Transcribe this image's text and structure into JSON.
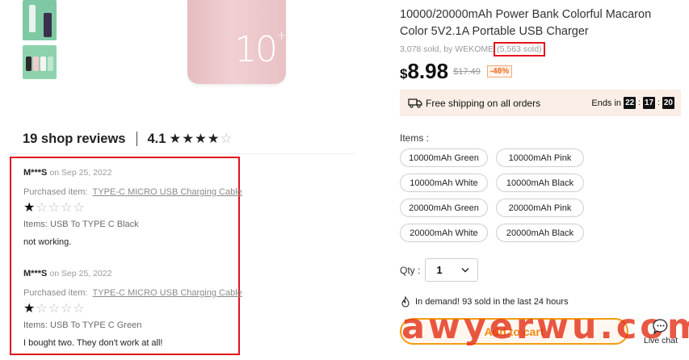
{
  "product": {
    "title": "10000/20000mAh Power Bank Colorful Macaron Color 5V2.1A Portable USB Charger",
    "sold_by": "3,078 sold, by WEKOME",
    "store_sold": "(5,563 sold)",
    "currency": "$",
    "price": "8.98",
    "old_price": "$17.49",
    "discount": "-48%",
    "hero_capacity": "10",
    "hero_plus": "+"
  },
  "shipping": {
    "label": "Free shipping on all orders",
    "ends_label": "Ends in",
    "timer": [
      "22",
      "17",
      "20"
    ]
  },
  "options": {
    "label": "Items :",
    "items": [
      "10000mAh Green",
      "10000mAh Pink",
      "10000mAh White",
      "10000mAh Black",
      "20000mAh Green",
      "20000mAh Pink",
      "20000mAh White",
      "20000mAh Black"
    ]
  },
  "quantity": {
    "label": "Qty :",
    "value": "1"
  },
  "demand": "In demand! 93 sold in the last 24 hours",
  "cart_button": "Add to cart",
  "live_chat": "Live chat",
  "watermark": "awyerwu.com",
  "shop_reviews": {
    "count_label": "19 shop reviews",
    "rating": "4.1",
    "stars": "★★★★",
    "empty_stars": "☆"
  },
  "reviews": [
    {
      "author": "M***S",
      "date": "on Sep 25, 2022",
      "purchased_label": "Purchased item:",
      "purchased_item": "TYPE-C MICRO USB Charging Cable",
      "stars_on": "★",
      "stars_off": "☆☆☆☆",
      "items": "Items: USB To TYPE C Black",
      "text": "not working."
    },
    {
      "author": "M***S",
      "date": "on Sep 25, 2022",
      "purchased_label": "Purchased item:",
      "purchased_item": "TYPE-C MICRO USB Charging Cable",
      "stars_on": "★",
      "stars_off": "☆☆☆☆",
      "items": "Items: USB To TYPE C Green",
      "text": "I bought two. They don't work at all!"
    }
  ],
  "colors": {
    "highlight_border": "#e0141e",
    "accent_orange": "#f39c12",
    "shipping_bg": "#fbeee6"
  }
}
